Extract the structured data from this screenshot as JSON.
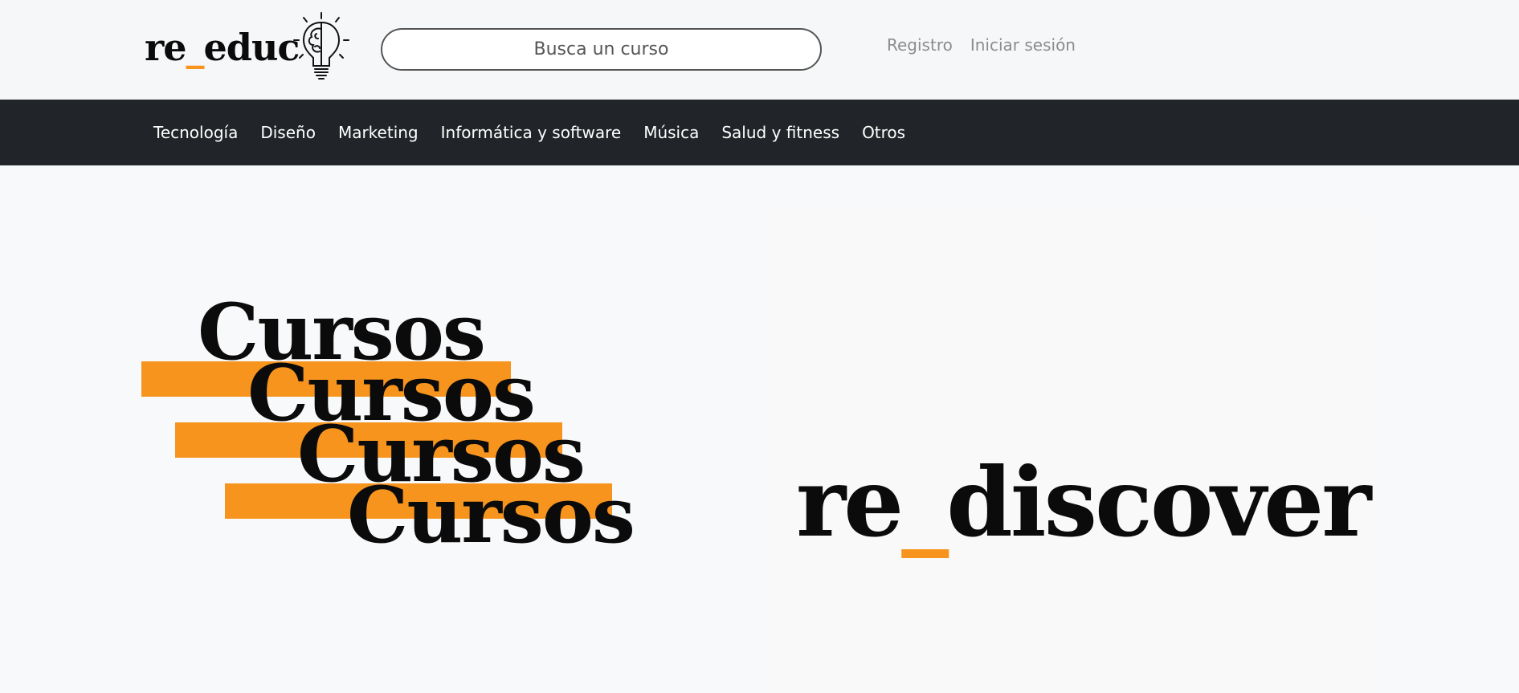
{
  "brand": {
    "logo_prefix": "re",
    "logo_underscore": "_",
    "logo_suffix": "educ",
    "logo_icon": "lightbulb-brain-icon",
    "accent_color": "#f7941d"
  },
  "search": {
    "placeholder": "Busca un curso"
  },
  "auth": {
    "register_label": "Registro",
    "login_label": "Iniciar sesión"
  },
  "nav": {
    "items": [
      {
        "label": "Tecnología"
      },
      {
        "label": "Diseño"
      },
      {
        "label": "Marketing"
      },
      {
        "label": "Informática y software"
      },
      {
        "label": "Música"
      },
      {
        "label": "Salud y fitness"
      },
      {
        "label": "Otros"
      }
    ]
  },
  "hero": {
    "repeated_word": [
      "Cursos",
      "Cursos",
      "Cursos",
      "Cursos"
    ],
    "tagline_prefix": "re",
    "tagline_underscore": "_",
    "tagline_suffix": "discover"
  },
  "colors": {
    "navbar_bg": "#212529",
    "page_bg": "#f8f9fa",
    "accent": "#f7941d"
  }
}
